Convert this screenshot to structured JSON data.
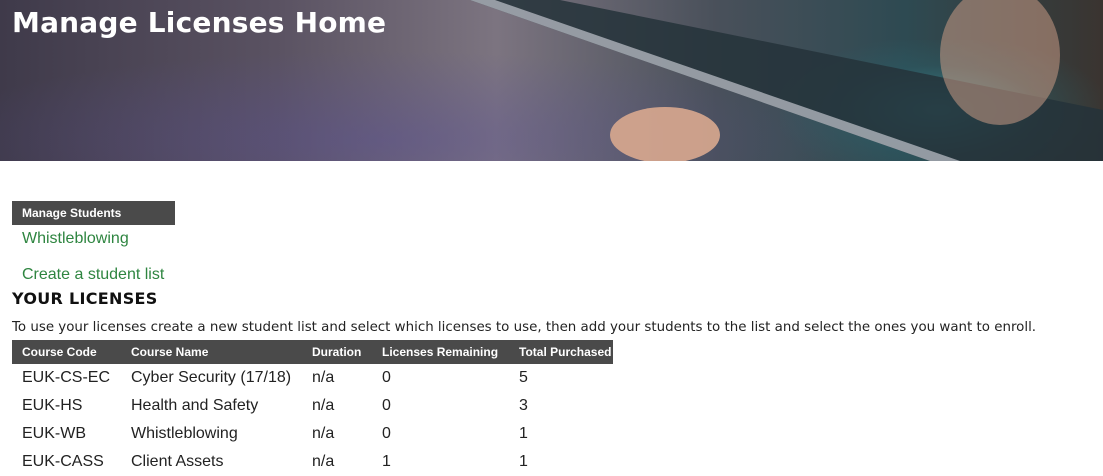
{
  "header": {
    "title": "Manage Licenses Home"
  },
  "manage_students": {
    "heading": "Manage Students",
    "links": [
      "Whistleblowing",
      "Create a student list"
    ]
  },
  "licenses": {
    "title": "YOUR LICENSES",
    "intro": "To use your licenses create a new student list and select which licenses to use, then add your students to the list and select the ones you want to enroll.",
    "columns": [
      "Course Code",
      "Course Name",
      "Duration",
      "Licenses Remaining",
      "Total Purchased"
    ],
    "rows": [
      [
        "EUK-CS-EC",
        "Cyber Security (17/18)",
        "n/a",
        "0",
        "5"
      ],
      [
        "EUK-HS",
        "Health and Safety",
        "n/a",
        "0",
        "3"
      ],
      [
        "EUK-WB",
        "Whistleblowing",
        "n/a",
        "0",
        "1"
      ],
      [
        "EUK-CASS",
        "Client Assets",
        "n/a",
        "1",
        "1"
      ]
    ]
  },
  "colors": {
    "link": "#2e8540",
    "header_bg": "#4a4a4a"
  }
}
